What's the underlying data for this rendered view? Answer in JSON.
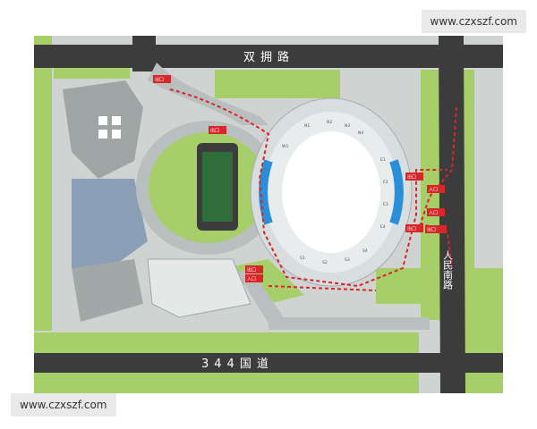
{
  "watermark": {
    "top": "www.czxszf.com",
    "bottom": "www.czxszf.com"
  },
  "roads": {
    "north": "双拥路",
    "south": "344国道",
    "east": "人民南路"
  },
  "gates": [
    "出口",
    "出口",
    "出口",
    "入口",
    "入口",
    "出口",
    "出口",
    "出口",
    "入口"
  ],
  "sections": [
    "N1",
    "N2",
    "N3",
    "N4",
    "S1",
    "S2",
    "S3",
    "S4",
    "W1",
    "E1",
    "E2",
    "E3",
    "E4"
  ],
  "colors": {
    "road": "#3c3c3c",
    "grass": "#a6cf6a",
    "ground": "#cfd4d3",
    "stadium": "#e8ecec",
    "seat_blue": "#2a8fd8",
    "route": "#d8262a",
    "pitch": "#2f6e3b"
  }
}
